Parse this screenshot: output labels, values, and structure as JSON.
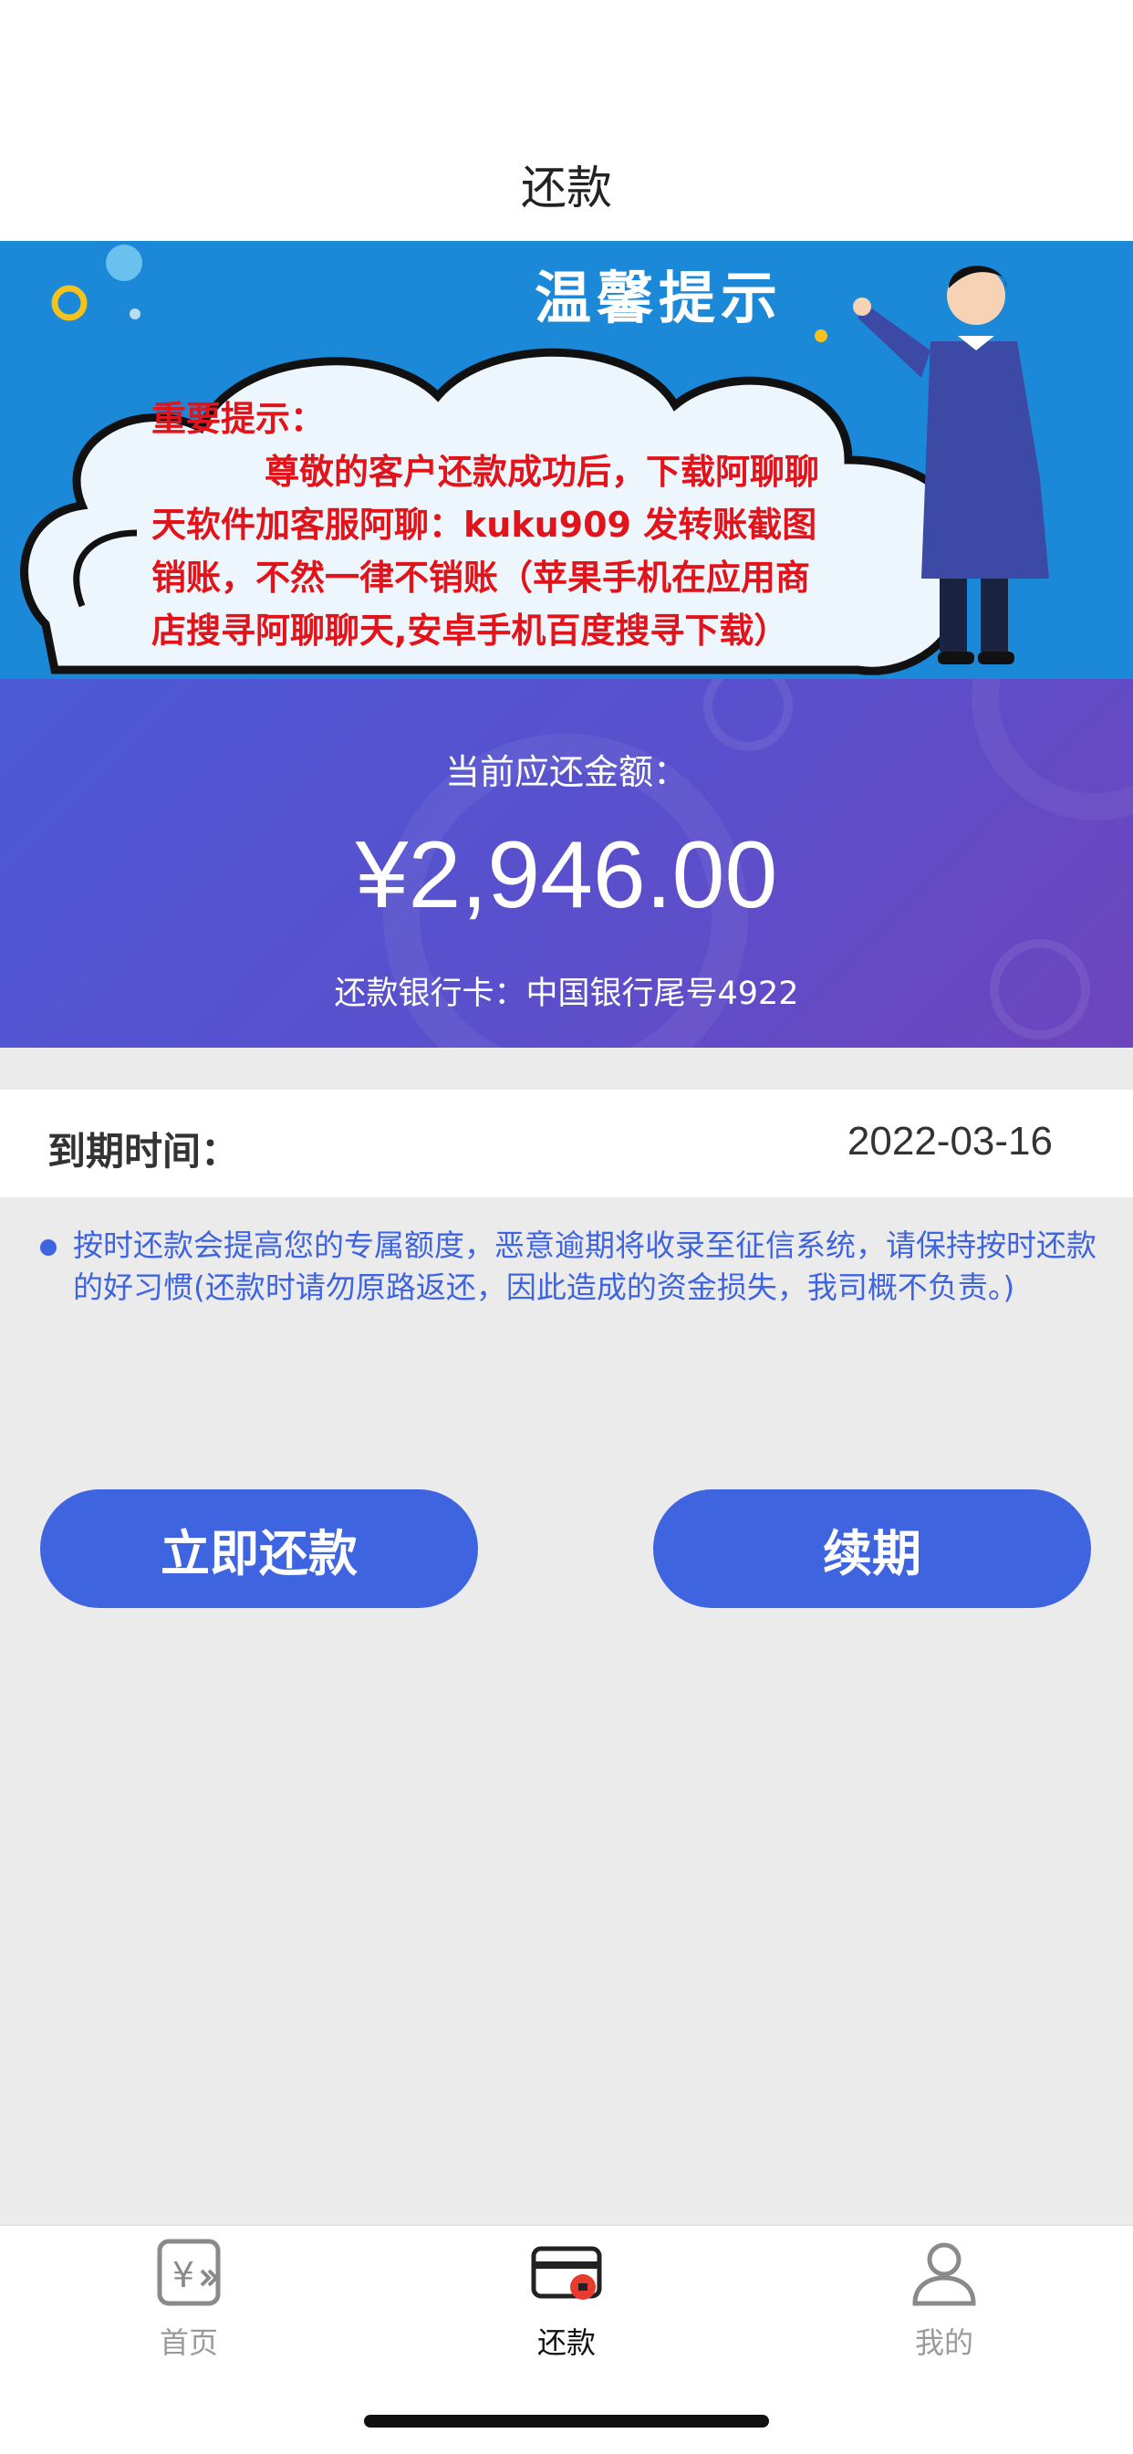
{
  "nav": {
    "title": "还款"
  },
  "notice": {
    "heading": "温馨提示",
    "title": "重要提示：",
    "body": "尊敬的客户还款成功后，下载阿聊聊天软件加客服阿聊：kuku909 发转账截图销账，不然一律不销账（苹果手机在应用商店搜寻阿聊聊天,安卓手机百度搜寻下载）"
  },
  "amount": {
    "label": "当前应还金额：",
    "value": "¥2,946.00",
    "bank_card": "还款银行卡：中国银行尾号4922"
  },
  "due": {
    "label": "到期时间：",
    "value": "2022-03-16"
  },
  "tip": {
    "text": "按时还款会提高您的专属额度，恶意逾期将收录至征信系统，请保持按时还款的好习惯(还款时请勿原路返还，因此造成的资金损失，我司概不负责。)"
  },
  "buttons": {
    "pay_now": "立即还款",
    "renew": "续期"
  },
  "tabs": [
    {
      "label": "首页",
      "icon": "yuan-card-icon",
      "active": false
    },
    {
      "label": "还款",
      "icon": "credit-card-icon",
      "active": true
    },
    {
      "label": "我的",
      "icon": "user-icon",
      "active": false
    }
  ],
  "colors": {
    "accent": "#3f64e0",
    "warning_text": "#e0141a",
    "banner_blue": "#1c88d8"
  }
}
